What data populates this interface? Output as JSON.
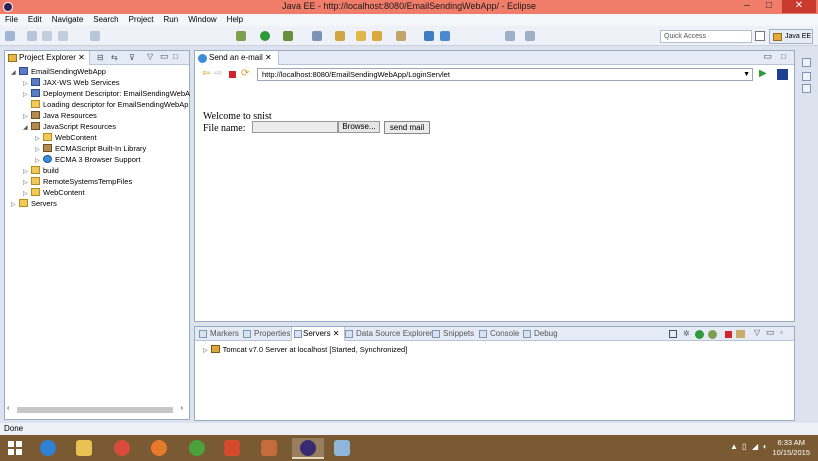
{
  "window": {
    "title": "Java EE - http://localhost:8080/EmailSendingWebApp/ - Eclipse",
    "minimize": "–",
    "maximize": "□",
    "close": "✕"
  },
  "menu": [
    "File",
    "Edit",
    "Navigate",
    "Search",
    "Project",
    "Run",
    "Window",
    "Help"
  ],
  "toolbar": {
    "quick_access_placeholder": "Quick Access",
    "perspective_label": "Java EE"
  },
  "project_explorer": {
    "tab_label": "Project Explorer",
    "tree": [
      {
        "label": "EmailSendingWebApp",
        "twisty": "◢",
        "icon": "project-icon"
      },
      {
        "label": "JAX-WS Web Services",
        "twisty": "▷",
        "icon": "web-services-icon"
      },
      {
        "label": "Deployment Descriptor: EmailSendingWebA",
        "twisty": "▷",
        "icon": "descriptor-icon"
      },
      {
        "label": "Loading descriptor for EmailSendingWebAp",
        "twisty": "",
        "icon": "loading-icon"
      },
      {
        "label": "Java Resources",
        "twisty": "▷",
        "icon": "java-resources-icon"
      },
      {
        "label": "JavaScript Resources",
        "twisty": "◢",
        "icon": "js-resources-icon"
      },
      {
        "label": "WebContent",
        "twisty": "▷",
        "icon": "folder-icon"
      },
      {
        "label": "ECMAScript Built-In Library",
        "twisty": "▷",
        "icon": "library-icon"
      },
      {
        "label": "ECMA 3 Browser Support",
        "twisty": "▷",
        "icon": "globe-icon"
      },
      {
        "label": "build",
        "twisty": "▷",
        "icon": "folder-icon"
      },
      {
        "label": "RemoteSystemsTempFiles",
        "twisty": "▷",
        "icon": "folder-icon"
      },
      {
        "label": "WebContent",
        "twisty": "▷",
        "icon": "folder-icon"
      },
      {
        "label": "Servers",
        "twisty": "▷",
        "icon": "servers-folder-icon"
      }
    ]
  },
  "editor": {
    "tab_label": "Send an e-mail",
    "url": "http://localhost:8080/EmailSendingWebApp/LoginServlet",
    "page": {
      "welcome": "Welcome to snist",
      "file_label": "File name:",
      "browse_label": "Browse...",
      "send_label": "send mail"
    }
  },
  "bottom_panel": {
    "tabs": [
      "Markers",
      "Properties",
      "Servers",
      "Data Source Explorer",
      "Snippets",
      "Console",
      "Debug"
    ],
    "active_tab": "Servers",
    "server_row": "Tomcat v7.0 Server at localhost  [Started, Synchronized]"
  },
  "status_bar": {
    "text": "Done"
  },
  "taskbar": {
    "time": "6:33 AM",
    "date": "10/15/2015"
  },
  "colors": {
    "title_bar": "#f07d6a",
    "taskbar": "#7a5a33",
    "panel_border": "#9aabc1"
  }
}
